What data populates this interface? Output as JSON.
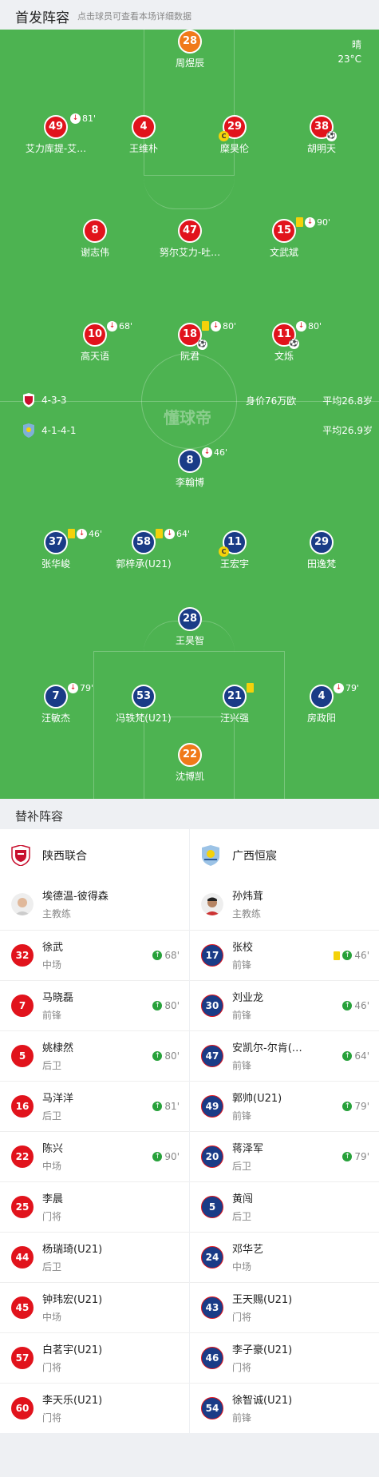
{
  "header": {
    "title": "首发阵容",
    "subtitle": "点击球员可查看本场详细数据"
  },
  "weather": {
    "condition": "晴",
    "temp": "23°C"
  },
  "watermark": "懂球帝",
  "home_formation": "4-3-3",
  "away_formation": "4-1-4-1",
  "home_value": "身价76万欧",
  "home_age": "平均26.8岁",
  "away_age": "平均26.9岁",
  "home_players": [
    {
      "num": "28",
      "name": "周煜辰",
      "gk": true
    },
    {
      "num": "49",
      "name": "艾力库提-艾…",
      "ev": "81'"
    },
    {
      "num": "4",
      "name": "王维朴"
    },
    {
      "num": "29",
      "name": "糜昊伦"
    },
    {
      "num": "38",
      "name": "胡明天"
    },
    {
      "num": "8",
      "name": "谢志伟"
    },
    {
      "num": "47",
      "name": "努尔艾力-吐…"
    },
    {
      "num": "15",
      "name": "文武斌",
      "ev": "90'"
    },
    {
      "num": "10",
      "name": "高天语",
      "ev": "68'"
    },
    {
      "num": "18",
      "name": "阮君",
      "ev": "80'"
    },
    {
      "num": "11",
      "name": "文烁",
      "ev": "80'"
    }
  ],
  "away_players": [
    {
      "num": "8",
      "name": "李翰博",
      "ev": "46'"
    },
    {
      "num": "37",
      "name": "张华峻",
      "ev": "46'"
    },
    {
      "num": "58",
      "name": "郭梓承(U21)",
      "ev": "64'"
    },
    {
      "num": "11",
      "name": "王宏宇"
    },
    {
      "num": "29",
      "name": "田逸梵"
    },
    {
      "num": "28",
      "name": "王昊智"
    },
    {
      "num": "7",
      "name": "汪敏杰",
      "ev": "79'"
    },
    {
      "num": "53",
      "name": "冯轶梵(U21)"
    },
    {
      "num": "21",
      "name": "汪兴强"
    },
    {
      "num": "4",
      "name": "房政阳",
      "ev": "79'"
    },
    {
      "num": "22",
      "name": "沈博凯",
      "gk": true
    }
  ],
  "subs_title": "替补阵容",
  "home": {
    "team": "陕西联合",
    "coach": "埃德温-彼得森",
    "coach_role": "主教练",
    "subs": [
      {
        "num": "32",
        "name": "徐武",
        "pos": "中场",
        "min": "68'"
      },
      {
        "num": "7",
        "name": "马晓磊",
        "pos": "前锋",
        "min": "80'"
      },
      {
        "num": "5",
        "name": "姚棣然",
        "pos": "后卫",
        "min": "80'"
      },
      {
        "num": "16",
        "name": "马洋洋",
        "pos": "后卫",
        "min": "81'"
      },
      {
        "num": "22",
        "name": "陈兴",
        "pos": "中场",
        "min": "90'"
      },
      {
        "num": "25",
        "name": "李晨",
        "pos": "门将",
        "min": ""
      },
      {
        "num": "44",
        "name": "杨瑞琦(U21)",
        "pos": "后卫",
        "min": ""
      },
      {
        "num": "45",
        "name": "钟玮宏(U21)",
        "pos": "中场",
        "min": ""
      },
      {
        "num": "57",
        "name": "白茗宇(U21)",
        "pos": "门将",
        "min": ""
      },
      {
        "num": "60",
        "name": "李天乐(U21)",
        "pos": "门将",
        "min": ""
      }
    ]
  },
  "away": {
    "team": "广西恒宸",
    "coach": "孙炜茸",
    "coach_role": "主教练",
    "subs": [
      {
        "num": "17",
        "name": "张校",
        "pos": "前锋",
        "min": "46'"
      },
      {
        "num": "30",
        "name": "刘业龙",
        "pos": "前锋",
        "min": "46'"
      },
      {
        "num": "47",
        "name": "安凯尔-尔肯(…",
        "pos": "前锋",
        "min": "64'"
      },
      {
        "num": "49",
        "name": "郭帅(U21)",
        "pos": "前锋",
        "min": "79'"
      },
      {
        "num": "20",
        "name": "蒋泽军",
        "pos": "后卫",
        "min": "79'"
      },
      {
        "num": "5",
        "name": "黄闯",
        "pos": "后卫",
        "min": ""
      },
      {
        "num": "24",
        "name": "邓华艺",
        "pos": "中场",
        "min": ""
      },
      {
        "num": "43",
        "name": "王天赐(U21)",
        "pos": "门将",
        "min": ""
      },
      {
        "num": "46",
        "name": "李子豪(U21)",
        "pos": "门将",
        "min": ""
      },
      {
        "num": "54",
        "name": "徐智诚(U21)",
        "pos": "前锋",
        "min": ""
      }
    ]
  }
}
